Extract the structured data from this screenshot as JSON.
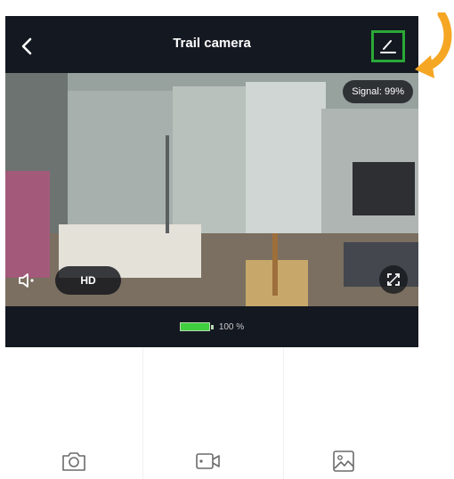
{
  "header": {
    "title": "Trail camera",
    "back_icon": "chevron-left-icon",
    "edit_icon": "pencil-icon",
    "highlight_color": "#2aa836"
  },
  "video": {
    "signal_text": "Signal: 99%",
    "hd_label": "HD",
    "mute_icon": "speaker-mute-icon",
    "fullscreen_icon": "fullscreen-icon"
  },
  "status": {
    "battery_text": "100 %",
    "battery_level": 1.0,
    "battery_color": "#3fcf3f"
  },
  "annotation": {
    "arrow_color": "#f5a623"
  },
  "actions": [
    {
      "icon": "camera-icon"
    },
    {
      "icon": "video-record-icon"
    },
    {
      "icon": "gallery-icon"
    }
  ]
}
